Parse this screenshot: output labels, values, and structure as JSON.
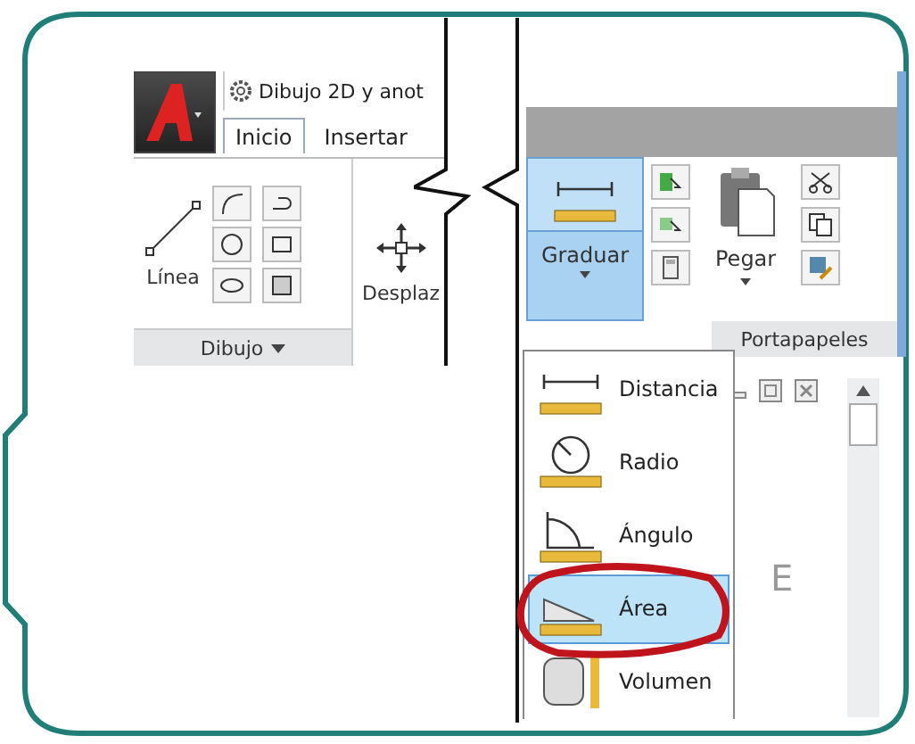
{
  "workspace": {
    "label": "Dibujo 2D y anot"
  },
  "tabs": [
    {
      "label": "Inicio",
      "selected": true
    },
    {
      "label": "Insertar",
      "selected": false
    }
  ],
  "draw_panel": {
    "line_tool": "Línea",
    "title": "Dibujo",
    "move_tool": "Desplaz"
  },
  "measure": {
    "label": "Graduar"
  },
  "clipboard": {
    "paste": "Pegar",
    "title": "Portapapeles"
  },
  "measure_menu": [
    {
      "kind": "distance",
      "label": "Distancia",
      "selected": false
    },
    {
      "kind": "radius",
      "label": "Radio",
      "selected": false
    },
    {
      "kind": "angle",
      "label": "Ángulo",
      "selected": false
    },
    {
      "kind": "area",
      "label": "Área",
      "selected": true
    },
    {
      "kind": "volume",
      "label": "Volumen",
      "selected": false
    }
  ],
  "viewcube": {
    "letter": "E"
  }
}
